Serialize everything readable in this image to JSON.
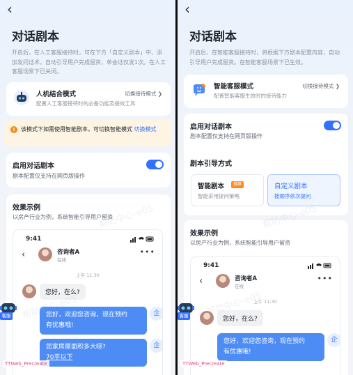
{
  "left": {
    "title": "对话剧本",
    "description": "开启后，在人工客服接待时，可在下方「自定义剧本」中、添加发问话术，自动引导用户完成留资，单会话仅发1次。在人工客服场景下已关闭。",
    "mode": {
      "name": "人机结合模式",
      "desc": "配置人工客服接待时的必备功能及提效工具",
      "switch_label": "切换接待模式 ❯"
    },
    "warning": {
      "text": "该模式下如需使用智能剧本，可切换智能模式",
      "link": "切换模式"
    },
    "script": {
      "title": "启用对话剧本",
      "desc": "剧本配置仅支持在网页版操作"
    },
    "example": {
      "title": "效果示例",
      "desc": "以房产行业为例，系统智能引导用户留资"
    },
    "chat": {
      "time": "9:41",
      "name": "咨询者A",
      "status": "在线",
      "timestamp": "上午 11:30",
      "user_msg": "您好，在么?",
      "reply1_line1": "您好，欢迎您咨询，现在预约",
      "reply1_line2": "有优惠哦!",
      "reply2_line1": "您家房屋面积多大呀?",
      "reply2_line2": "70平以下",
      "agent_icon": "企"
    }
  },
  "right": {
    "title": "对话剧本",
    "description": "开启后，在智能客服接待时，将根据下方剧本配置内容，自动引导用户完成留资。在智能客服场景下已生效。",
    "mode": {
      "name": "智能客服模式",
      "desc": "配置智能客服生效时的接待能力",
      "switch_label": "切换接待模式 ❯"
    },
    "script": {
      "title": "启用对话剧本",
      "desc": "剧本配置仅支持在网页版操作"
    },
    "guide": {
      "title": "剧本引导方式",
      "smart": {
        "title": "智能剧本",
        "badge": "推荐",
        "desc": "智能采用提问策略"
      },
      "custom": {
        "title": "自定义剧本",
        "desc": "按顺序依次提问"
      }
    },
    "example": {
      "title": "效果示例",
      "desc": "以房产行业为例，系统智能引导用户留资"
    },
    "chat": {
      "time": "9:41",
      "name": "咨询者A",
      "status": "在线",
      "timestamp": "上午 11:30",
      "user_msg": "您好，在么?",
      "reply1_line1": "您好，欢迎您咨询，现在预约",
      "reply1_line2": "有优惠哦!",
      "agent_icon": "企"
    }
  },
  "floating": {
    "robot_label": "客服",
    "watermark": "帮助中心-e05",
    "debug_tag": "TTWeb_Precreate"
  },
  "colors": {
    "accent": "#3370ff",
    "warning_bg": "#fdf4e3",
    "warning_icon": "#f28c1c",
    "bubble_out": "#4d8bf5",
    "badge": "#ff8a1f"
  },
  "icons": {
    "back": "back-chevron-icon",
    "robot": "robot-icon",
    "smart_bot": "smart-bot-icon",
    "more": "more-dots-icon",
    "warning": "warning-icon"
  }
}
